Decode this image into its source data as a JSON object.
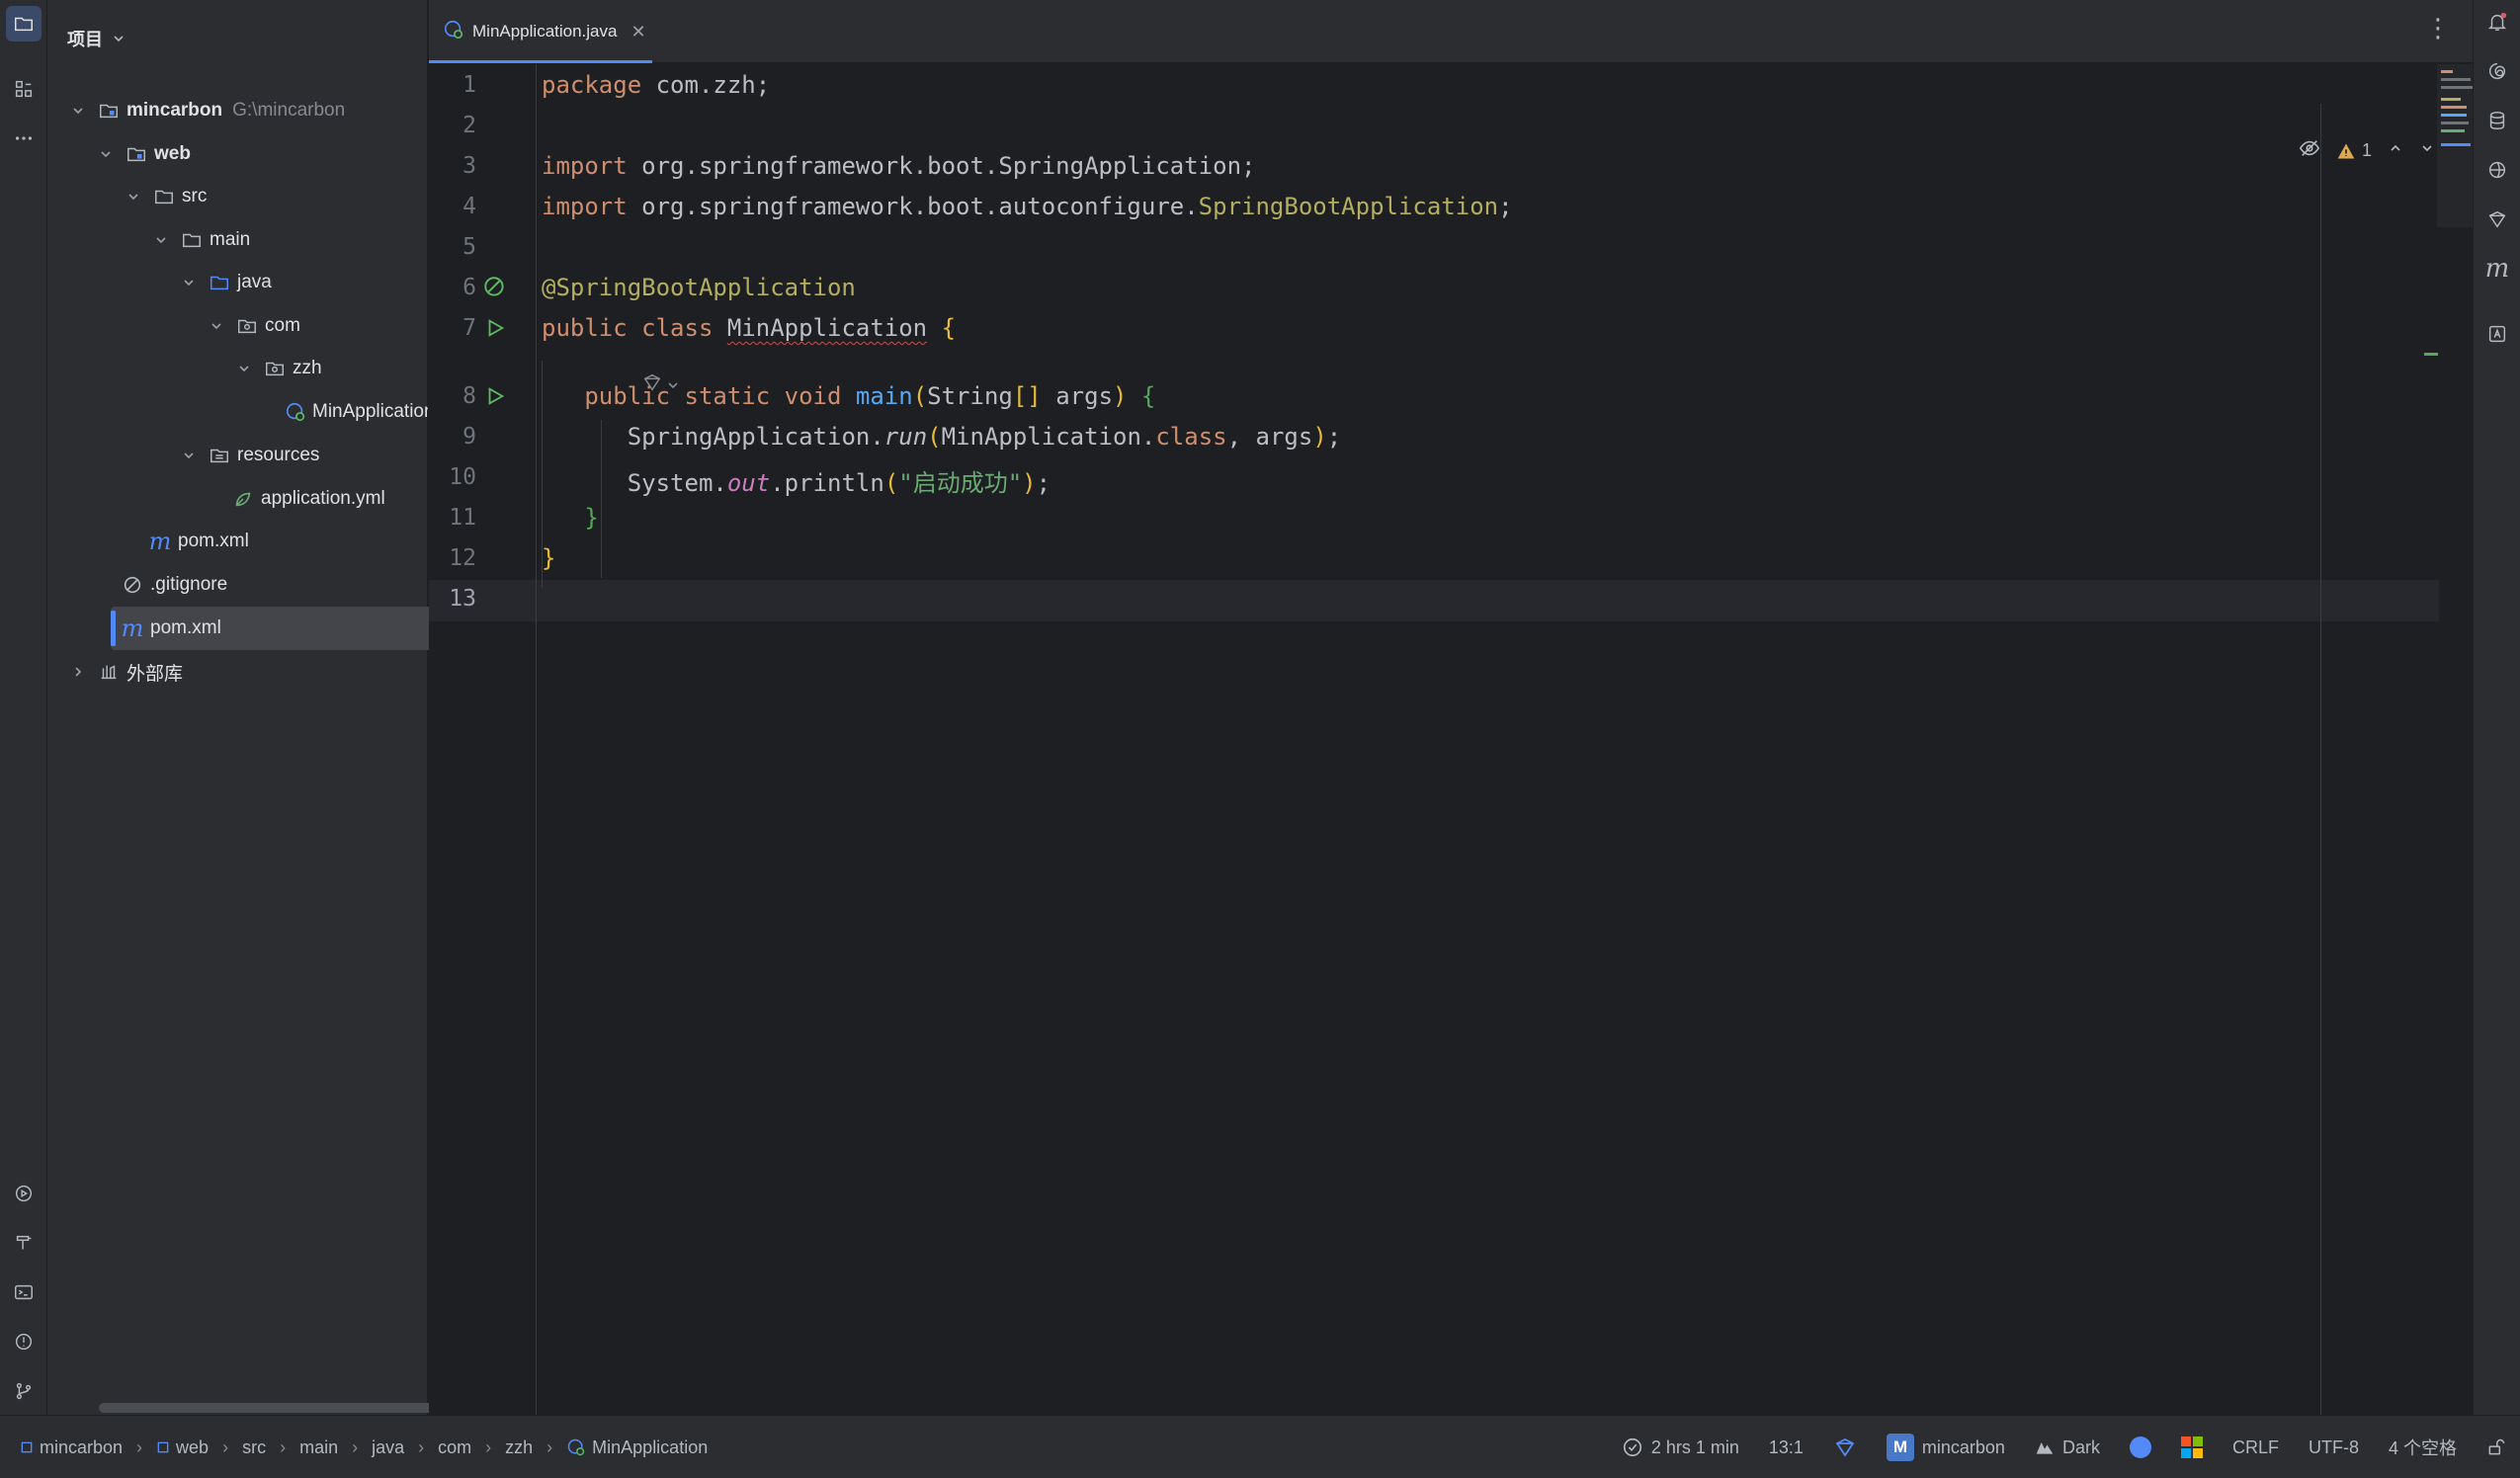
{
  "project_panel": {
    "title": "项目",
    "tree": [
      {
        "label": "mincarbon",
        "path": "G:\\mincarbon"
      },
      {
        "label": "web"
      },
      {
        "label": "src"
      },
      {
        "label": "main"
      },
      {
        "label": "java"
      },
      {
        "label": "com"
      },
      {
        "label": "zzh"
      },
      {
        "label": "MinApplication"
      },
      {
        "label": "resources"
      },
      {
        "label": "application.yml"
      },
      {
        "label": "pom.xml"
      },
      {
        "label": ".gitignore"
      },
      {
        "label": "pom.xml"
      },
      {
        "label": "外部库"
      }
    ]
  },
  "editor": {
    "tab_label": "MinApplication.java",
    "warning_count": "1",
    "line_numbers": [
      "1",
      "2",
      "3",
      "4",
      "5",
      "6",
      "7",
      "8",
      "9",
      "10",
      "11",
      "12",
      "13"
    ],
    "code": {
      "l1_kw": "package",
      "l1_rest": " com.zzh;",
      "l3_kw": "import",
      "l3_rest": " org.springframework.boot.SpringApplication;",
      "l4_kw": "import",
      "l4_rest": " org.springframework.boot.autoconfigure.",
      "l4_cls": "SpringBootApplication",
      "l4_end": ";",
      "l6_ann": "@SpringBootApplication",
      "l7_kw": "public class ",
      "l7_cls": "MinApplication",
      "l7_brace": "{",
      "l8_kw": "public static void ",
      "l8_fn": "main",
      "l8_paren_open": "(",
      "l8_type": "String",
      "l8_arr": "[]",
      "l8_args": " args",
      "l8_paren_close": ")",
      "l8_brace": "{",
      "l9_a": "SpringApplication.",
      "l9_run": "run",
      "l9_paren_open": "(",
      "l9_b": "MinApplication.",
      "l9_class": "class",
      "l9_c": ", args",
      "l9_paren_close": ")",
      "l9_end": ";",
      "l10_a": "System.",
      "l10_out": "out",
      "l10_b": ".println",
      "l10_paren_open": "(",
      "l10_str": "\"启动成功\"",
      "l10_paren_close": ")",
      "l10_end": ";",
      "l11_brace": "}",
      "l12_brace": "}"
    }
  },
  "status_bar": {
    "breadcrumbs": [
      "mincarbon",
      "web",
      "src",
      "main",
      "java",
      "com",
      "zzh",
      "MinApplication"
    ],
    "time_tracked": "2 hrs 1 min",
    "caret": "13:1",
    "m_badge": "M",
    "project": "mincarbon",
    "theme": "Dark",
    "line_sep": "CRLF",
    "encoding": "UTF-8",
    "indent": "4 个空格"
  },
  "colors": {
    "accent": "#548af7",
    "keyword": "#cf8e6d",
    "annotation": "#b3ae60",
    "function": "#56a8f5",
    "string": "#6aab73",
    "static_field": "#c77dbb",
    "run_green": "#5fb865"
  }
}
